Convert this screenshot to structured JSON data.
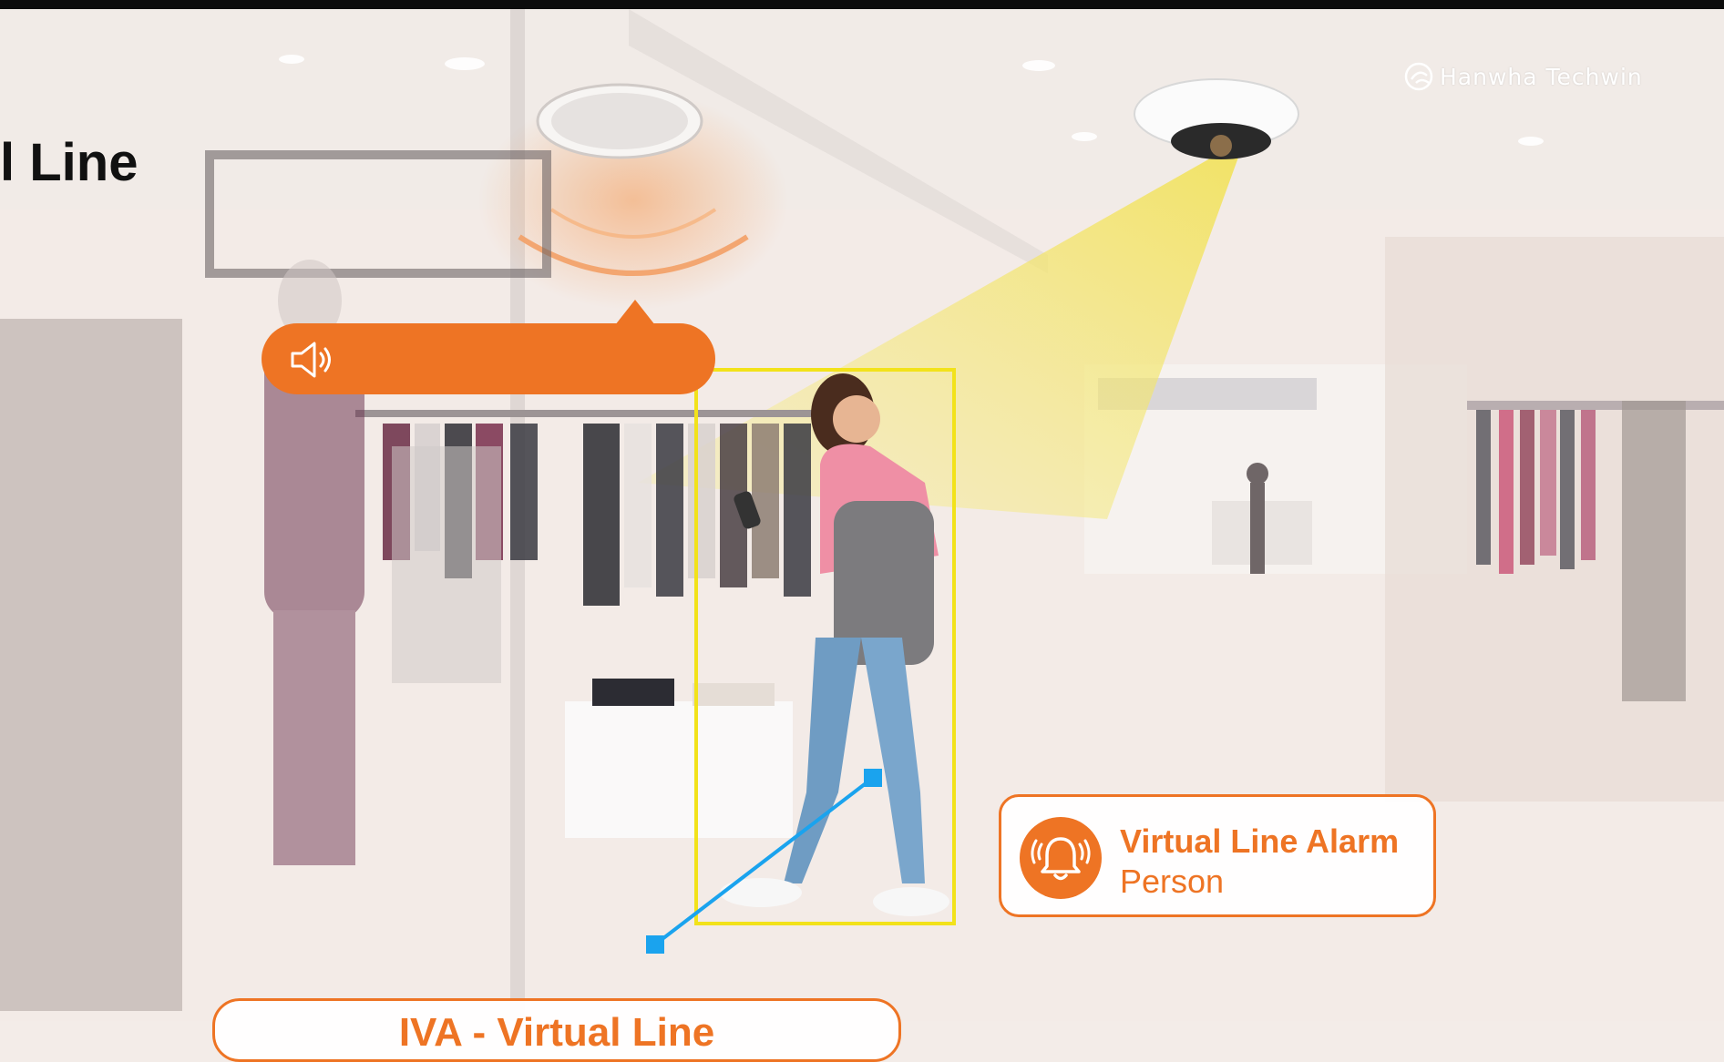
{
  "title": "l Line",
  "brand": {
    "name": "Hanwha Techwin"
  },
  "alarm": {
    "title": "Virtual Line Alarm",
    "subtitle": "Person",
    "icon": "bell-ringing-icon"
  },
  "speaker": {
    "icon": "speaker-icon"
  },
  "footer": {
    "label": "IVA - Virtual Line"
  },
  "colors": {
    "accent": "#ee7424",
    "detection_box": "#f2e21a",
    "virtual_line": "#1aa3ee",
    "camera_cone": "#f3e66a"
  }
}
